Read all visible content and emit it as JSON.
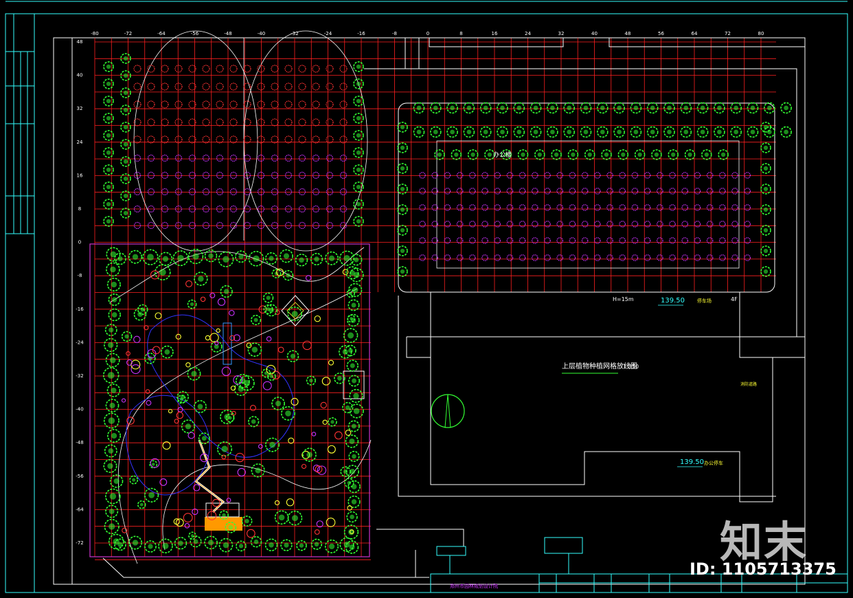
{
  "drawing": {
    "title": "上层植物种植网格放线图",
    "scale": "1:350",
    "elevation_top": "139.50",
    "elevation_bottom": "139.50",
    "height_note": "H=15m",
    "floor_note": "4F",
    "building_label": "办公楼",
    "road_label": "停车场",
    "lower_label": "办公停车",
    "side_note": "消防道路",
    "titleblock_project": "郑州市园林规划设计院",
    "axis_x": [
      "-80",
      "-72",
      "-64",
      "-56",
      "-48",
      "-40",
      "-32",
      "-24",
      "-16",
      "-8",
      "0",
      "8",
      "16",
      "24",
      "32",
      "40",
      "48",
      "56",
      "64",
      "72",
      "80"
    ],
    "axis_y": [
      "48",
      "40",
      "32",
      "24",
      "16",
      "8",
      "0",
      "-8",
      "-16",
      "-24",
      "-32",
      "-40",
      "-48",
      "-56",
      "-64",
      "-72"
    ]
  },
  "colors": {
    "background": "#000000",
    "grid": "#ff2020",
    "border": "#33ffff",
    "wall": "#ffffff",
    "planting_area": "#cc33cc",
    "tree": "#33ff33",
    "shrub": "#cc33ff",
    "flower": "#ffff33"
  },
  "watermark": {
    "logo": "知末",
    "id": "ID: 1105713375"
  }
}
